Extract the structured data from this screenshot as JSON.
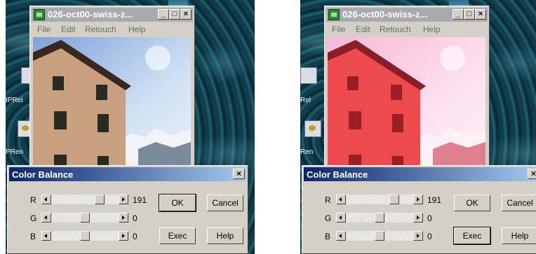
{
  "panels": [
    {
      "id": "left",
      "window_title": "026-oct00-swiss-z...",
      "desktop_labels": [
        "IPRel",
        "PRen"
      ],
      "menu": [
        "File",
        "Edit",
        "Retouch",
        "Help"
      ],
      "dialog": {
        "title": "Color Balance",
        "channels": [
          {
            "label": "R",
            "value": "191",
            "level": 0.75
          },
          {
            "label": "G",
            "value": "0",
            "level": 0.5
          },
          {
            "label": "B",
            "value": "0",
            "level": 0.5
          }
        ],
        "buttons": {
          "ok": "OK",
          "cancel": "Cancel",
          "exec": "Exec",
          "help": "Help"
        },
        "default_button": "ok"
      },
      "tint": false
    },
    {
      "id": "right",
      "window_title": "026-oct00-swiss-z...",
      "desktop_labels": [
        "Rel",
        "Ren"
      ],
      "menu": [
        "File",
        "Edit",
        "Retouch",
        "Help"
      ],
      "dialog": {
        "title": "Color Balance",
        "channels": [
          {
            "label": "R",
            "value": "191",
            "level": 0.75
          },
          {
            "label": "G",
            "value": "0",
            "level": 0.5
          },
          {
            "label": "B",
            "value": "0",
            "level": 0.5
          }
        ],
        "buttons": {
          "ok": "OK",
          "cancel": "Cancel",
          "exec": "Exec",
          "help": "Help"
        },
        "default_button": "exec"
      },
      "tint": true
    }
  ],
  "icons": {
    "app": "image-app-icon",
    "minimize": "minimize-icon",
    "maximize": "maximize-icon",
    "close": "close-icon",
    "arrow_left": "arrow-left-icon",
    "arrow_right": "arrow-right-icon"
  },
  "colors": {
    "dialog_title_start": "#0a246a",
    "dialog_title_end": "#a6caf0",
    "window_face": "#d4d0c8",
    "tint": "#ff2a4a"
  }
}
